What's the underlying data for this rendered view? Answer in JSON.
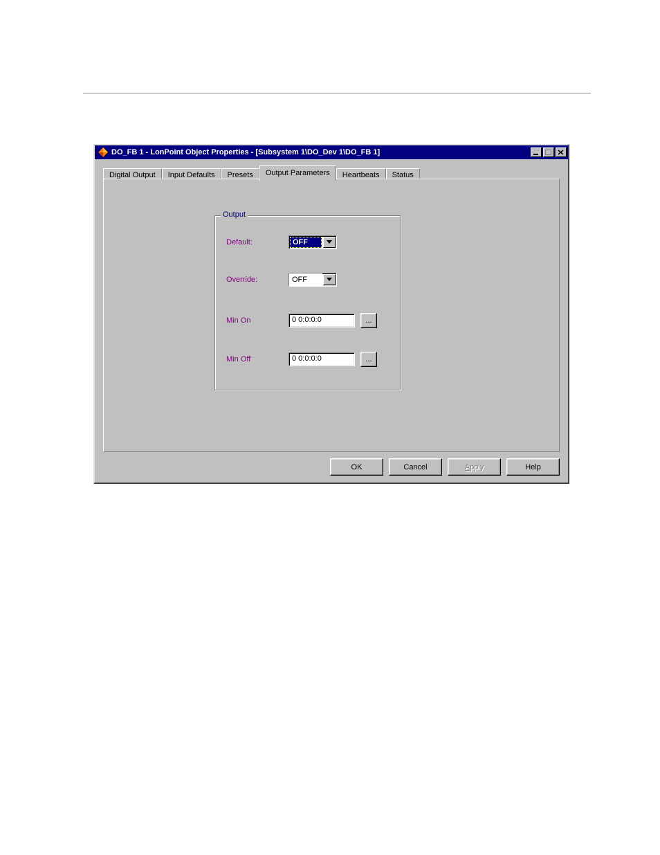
{
  "titlebar": {
    "text": "DO_FB 1 - LonPoint Object Properties - [Subsystem 1\\DO_Dev 1\\DO_FB 1]"
  },
  "tabs": {
    "items": [
      "Digital Output",
      "Input Defaults",
      "Presets",
      "Output Parameters",
      "Heartbeats",
      "Status"
    ],
    "active_index": 3
  },
  "group": {
    "title": "Output",
    "fields": {
      "default": {
        "label": "Default:",
        "value": "OFF"
      },
      "override": {
        "label": "Override:",
        "value": "OFF"
      },
      "min_on": {
        "label": "Min On",
        "value": "0 0:0:0:0",
        "ellipsis": "..."
      },
      "min_off": {
        "label": "Min Off",
        "value": "0 0:0:0:0",
        "ellipsis": "..."
      }
    }
  },
  "buttons": {
    "ok": "OK",
    "cancel": "Cancel",
    "apply": "Apply",
    "help": "Help"
  }
}
